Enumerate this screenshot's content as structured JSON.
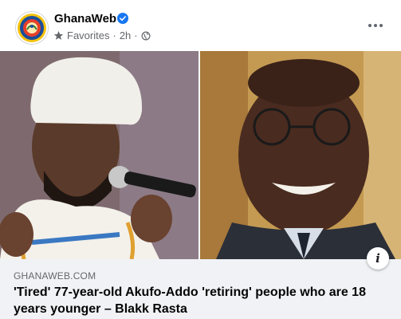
{
  "post": {
    "page_name": "GhanaWeb",
    "audience": "Favorites",
    "time": "2h",
    "separator": "·",
    "icons": {
      "verified": "verified-badge-icon",
      "favorites": "star-icon",
      "audience": "globe-icon",
      "more": "more-options-icon",
      "info": "info-icon"
    },
    "colors": {
      "verified": "#1877f2",
      "link_bg": "#f0f2f5",
      "meta_text": "#65676b"
    }
  },
  "link": {
    "domain": "GHANAWEB.COM",
    "headline": "'Tired' 77-year-old Akufo-Addo 'retiring' people who are 18 years younger – Blakk Rasta",
    "info_glyph": "i"
  }
}
